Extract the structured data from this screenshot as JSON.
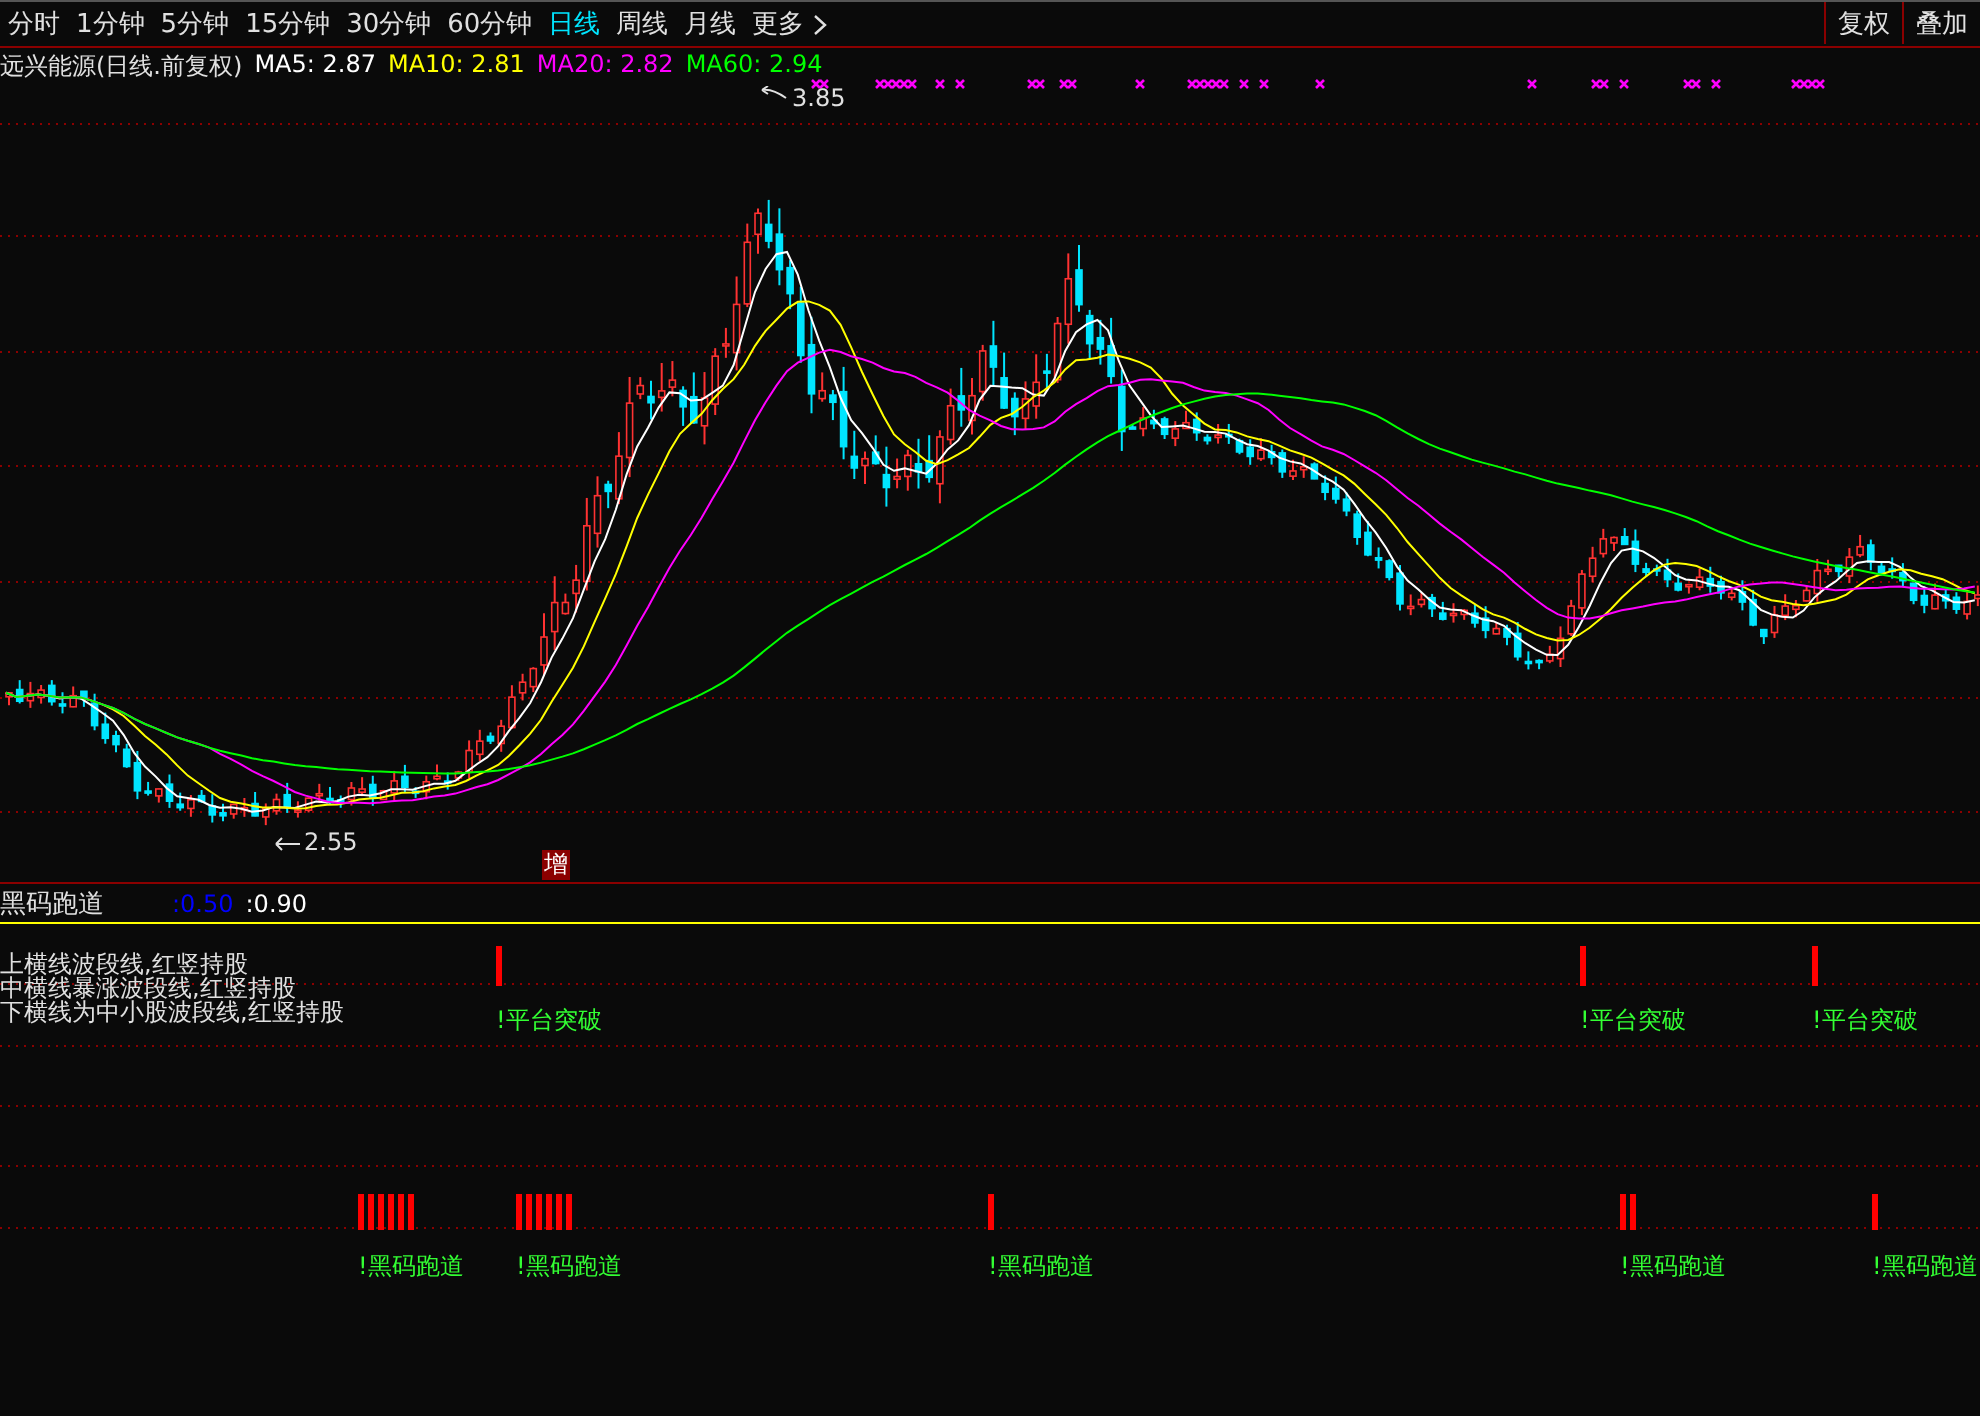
{
  "toolbar": {
    "periods": [
      {
        "label": "分时",
        "selected": false
      },
      {
        "label": "1分钟",
        "selected": false
      },
      {
        "label": "5分钟",
        "selected": false
      },
      {
        "label": "15分钟",
        "selected": false
      },
      {
        "label": "30分钟",
        "selected": false
      },
      {
        "label": "60分钟",
        "selected": false
      },
      {
        "label": "日线",
        "selected": true
      },
      {
        "label": "周线",
        "selected": false
      },
      {
        "label": "月线",
        "selected": false
      }
    ],
    "more": "更多",
    "buttons": [
      "复权",
      "叠加"
    ]
  },
  "main_pane": {
    "title": "远兴能源(日线.前复权)",
    "ma": [
      {
        "name": "MA5:",
        "value": "2.87",
        "color": "#ffffff"
      },
      {
        "name": "MA10:",
        "value": "2.81",
        "color": "#ffff00"
      },
      {
        "name": "MA20:",
        "value": "2.82",
        "color": "#ff00ff"
      },
      {
        "name": "MA60:",
        "value": "2.94",
        "color": "#00ff00"
      }
    ],
    "high_label": "3.85",
    "low_label": "2.55",
    "badge": "增"
  },
  "indicator": {
    "name": "黑码跑道",
    "values": [
      {
        "text": ":0.50",
        "color": "#0000ff"
      },
      {
        "text": ":0.90",
        "color": "#ffffff"
      }
    ],
    "notes": [
      "上横线波段线,红竖持股",
      "中横线暴涨波段线,红竖持股",
      "下横线为中小股波段线,红竖持股"
    ],
    "signals": [
      {
        "kind": "platform",
        "label": "!平台突破"
      },
      {
        "kind": "platform",
        "label": "!平台突破"
      },
      {
        "kind": "platform",
        "label": "!平台突破"
      },
      {
        "kind": "runway",
        "label": "!黑码跑道"
      },
      {
        "kind": "runway",
        "label": "!黑码跑道"
      },
      {
        "kind": "runway",
        "label": "!黑码跑道"
      },
      {
        "kind": "runway",
        "label": "!黑码跑道"
      },
      {
        "kind": "runway",
        "label": "!黑码跑道"
      }
    ]
  }
}
